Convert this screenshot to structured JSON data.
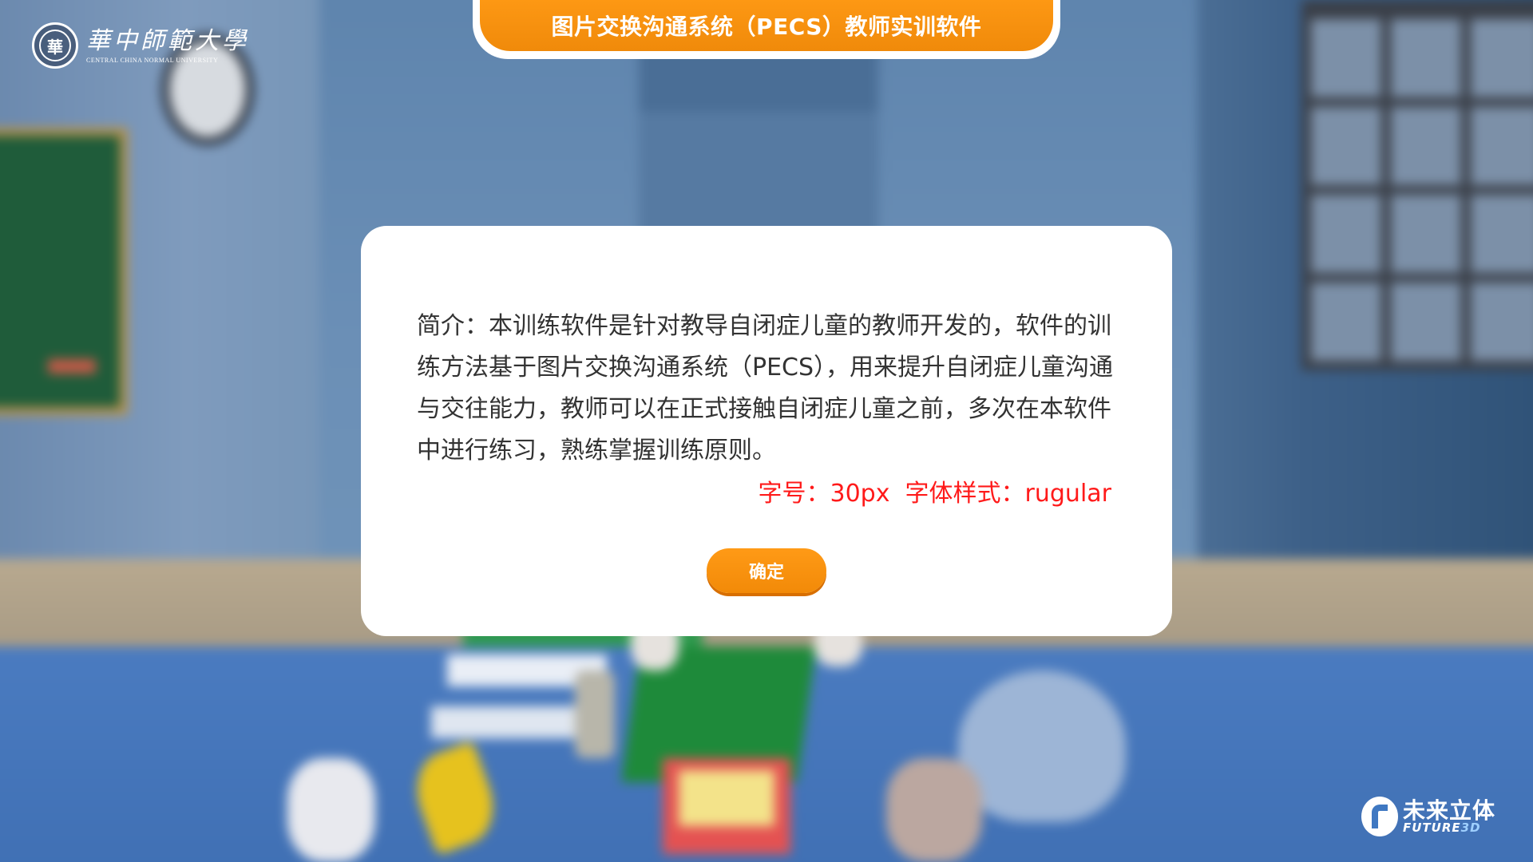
{
  "header": {
    "title": "图片交换沟通系统（PECS）教师实训软件"
  },
  "university_logo": {
    "name_cn": "華中師範大學",
    "name_en": "CENTRAL CHINA NORMAL UNIVERSITY",
    "seal_char": "華"
  },
  "dialog": {
    "intro_text": "简介：本训练软件是针对教导自闭症儿童的教师开发的，软件的训练方法基于图片交换沟通系统（PECS），用来提升自闭症儿童沟通与交往能力，教师可以在正式接触自闭症儿童之前，多次在本软件中进行练习，熟练掌握训练原则。",
    "style_note": "字号：30px  字体样式：rugular",
    "confirm_label": "确定"
  },
  "brand_logo": {
    "name_cn": "未来立体",
    "name_en": "FUTURE",
    "name_en_suffix": "3D"
  },
  "colors": {
    "accent_orange": "#f28a08",
    "note_red": "#ff1a1a",
    "dialog_bg": "#ffffff"
  }
}
